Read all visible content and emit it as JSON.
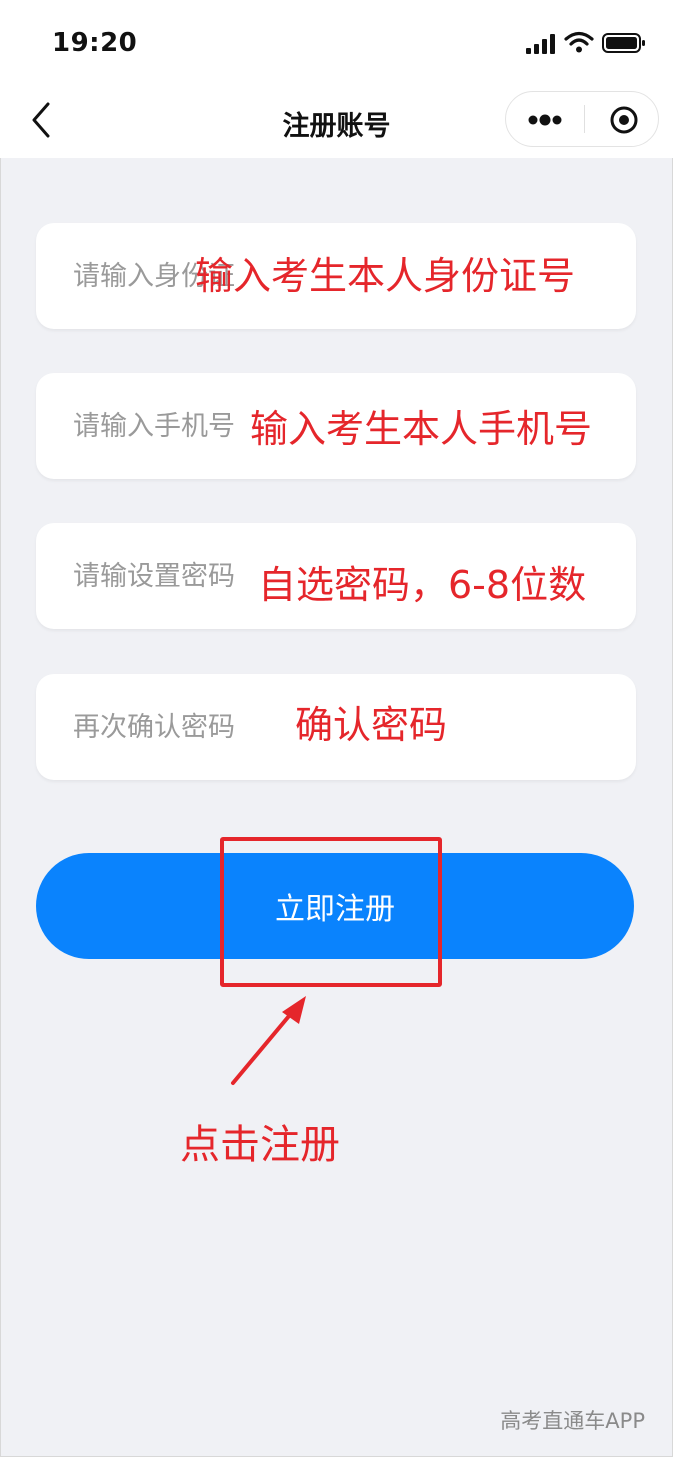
{
  "status_bar": {
    "time": "19:20"
  },
  "nav": {
    "title": "注册账号"
  },
  "form": {
    "id_placeholder": "请输入身份证",
    "phone_placeholder": "请输入手机号",
    "password_placeholder": "请输设置密码",
    "confirm_placeholder": "再次确认密码",
    "submit_label": "立即注册"
  },
  "annotations": {
    "id_note": "输入考生本人身份证号",
    "phone_note": "输入考生本人手机号",
    "password_note": "自选密码，6-8位数",
    "confirm_note": "确认密码",
    "click_note": "点击注册"
  },
  "watermark": "高考直通车APP",
  "colors": {
    "accent": "#0a83fd",
    "annotation": "#e5262b",
    "background": "#f0f1f5"
  }
}
